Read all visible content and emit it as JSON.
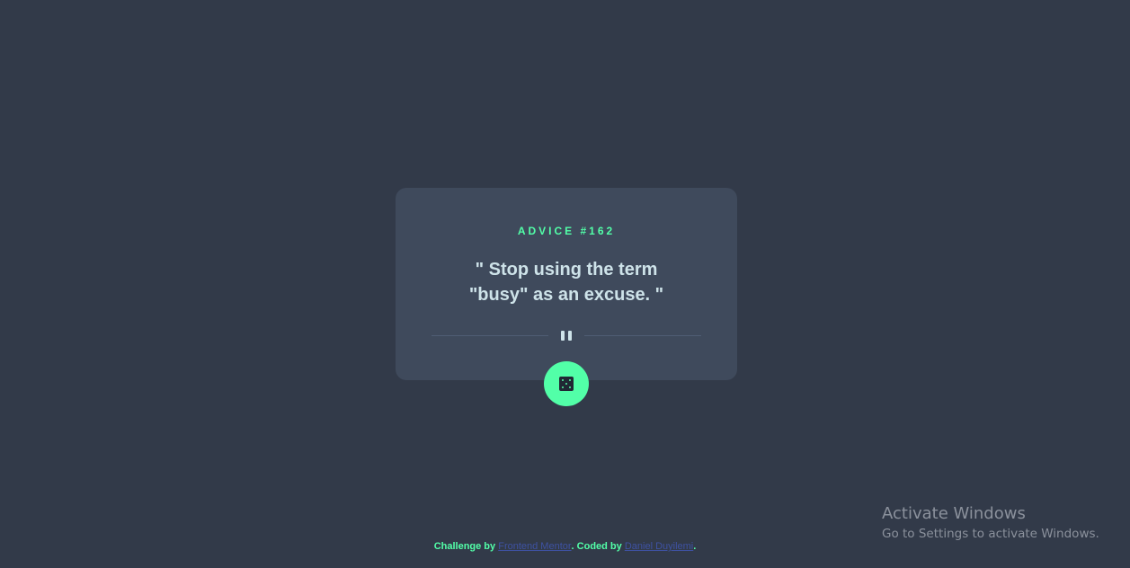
{
  "card": {
    "advice_id": "ADVICE #162",
    "advice_text": "\" Stop using the term \"busy\" as an excuse. \""
  },
  "dice_button": {
    "icon": "dice-icon"
  },
  "divider": {
    "icon": "pause-icon"
  },
  "footer": {
    "challenge_by": "Challenge by ",
    "frontend_mentor": "Frontend Mentor",
    "coded_by": ". Coded by ",
    "author": "Daniel Duyilemi",
    "end": "."
  },
  "watermark": {
    "title": "Activate Windows",
    "subtitle": "Go to Settings to activate Windows."
  },
  "colors": {
    "background": "#323a49",
    "card": "#3f4a5c",
    "accent": "#52ffa8",
    "text": "#cee3e9",
    "link": "#3e52a3"
  }
}
